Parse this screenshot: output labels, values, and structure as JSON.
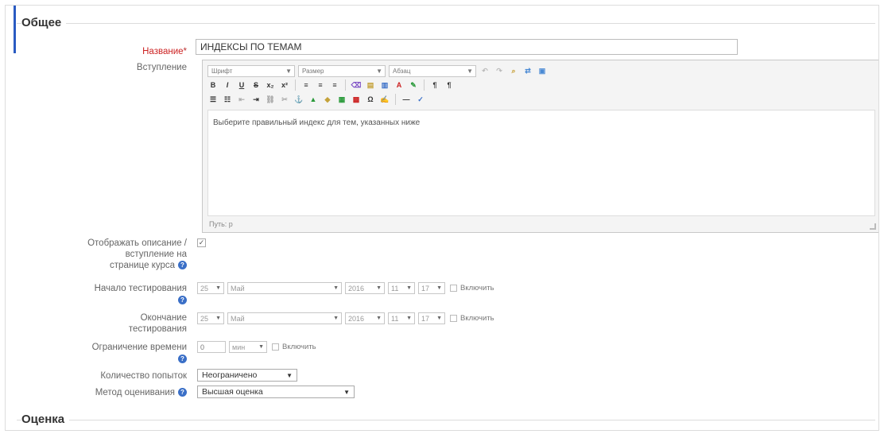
{
  "sections": {
    "general": "Общее",
    "grade": "Оценка"
  },
  "name_field": {
    "label": "Название",
    "required_mark": "*",
    "value": "ИНДЕКСЫ ПО ТЕМАМ"
  },
  "intro": {
    "label": "Вступление",
    "toolbar": {
      "font": "Шрифт",
      "size": "Размер",
      "paragraph": "Абзац"
    },
    "content": "Выберите правильный индекс для тем, указанных ниже",
    "path": "Путь: p"
  },
  "show_description": {
    "label_lines": [
      "Отображать описание /",
      "вступление на",
      "странице курса"
    ],
    "checked": true,
    "check_glyph": "✓"
  },
  "open_time": {
    "label": "Начало тестирования",
    "day": "25",
    "month": "Май",
    "year": "2016",
    "hour": "11",
    "minute": "17",
    "enable_label": "Включить"
  },
  "close_time": {
    "label_lines": [
      "Окончание",
      "тестирования"
    ],
    "day": "25",
    "month": "Май",
    "year": "2016",
    "hour": "11",
    "minute": "17",
    "enable_label": "Включить"
  },
  "time_limit": {
    "label": "Ограничение времени",
    "value": "0",
    "unit": "мин",
    "enable_label": "Включить"
  },
  "attempts": {
    "label": "Количество попыток",
    "value": "Неограничено"
  },
  "grading_method": {
    "label": "Метод оценивания",
    "value": "Высшая оценка"
  },
  "icons": {
    "help": "?",
    "dropdown_arrow": "▼"
  },
  "colors": {
    "required": "#c22222",
    "help_icon": "#3a6fc7",
    "accent_bar": "#2a5bc2"
  }
}
